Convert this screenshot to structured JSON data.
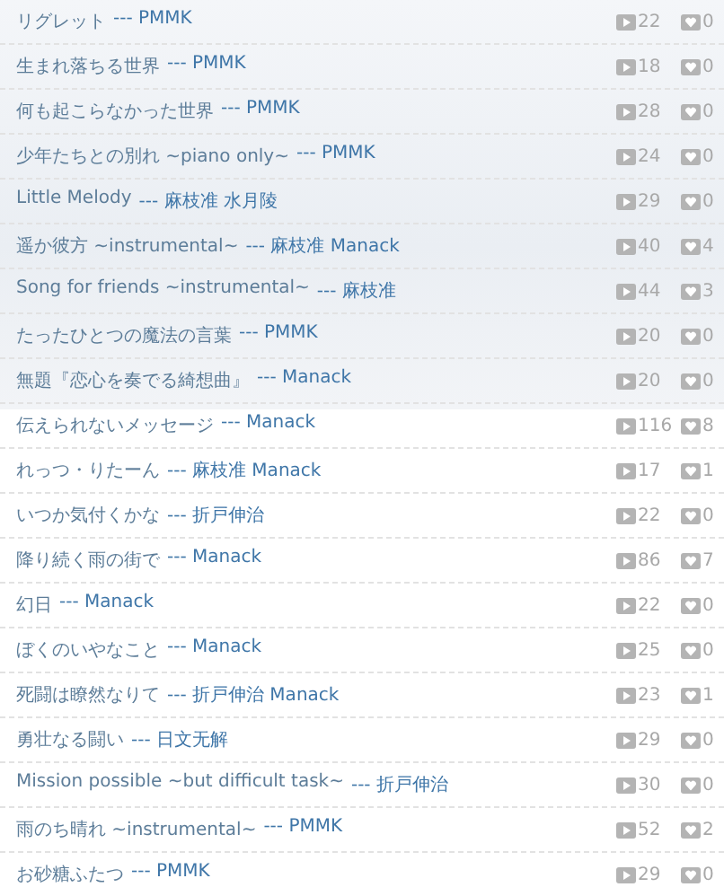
{
  "songs": [
    {
      "title": "リグレット",
      "credit": "--- PMMK",
      "plays": "22",
      "likes": "0"
    },
    {
      "title": "生まれ落ちる世界",
      "credit": "--- PMMK",
      "plays": "18",
      "likes": "0"
    },
    {
      "title": "何も起こらなかった世界",
      "credit": "--- PMMK",
      "plays": "28",
      "likes": "0"
    },
    {
      "title": "少年たちとの別れ ~piano only~",
      "credit": "--- PMMK",
      "plays": "24",
      "likes": "0"
    },
    {
      "title": "Little Melody",
      "credit": "--- 麻枝准 水月陵",
      "plays": "29",
      "likes": "0"
    },
    {
      "title": "遥か彼方 ~instrumental~",
      "credit": "--- 麻枝准 Manack",
      "plays": "40",
      "likes": "4"
    },
    {
      "title": "Song for friends ~instrumental~",
      "credit": "--- 麻枝准",
      "plays": "44",
      "likes": "3"
    },
    {
      "title": "たったひとつの魔法の言葉",
      "credit": "--- PMMK",
      "plays": "20",
      "likes": "0"
    },
    {
      "title": "無題『恋心を奏でる綺想曲』",
      "credit": "--- Manack",
      "plays": "20",
      "likes": "0"
    },
    {
      "title": "伝えられないメッセージ",
      "credit": "--- Manack",
      "plays": "116",
      "likes": "8"
    },
    {
      "title": "れっつ・りたーん",
      "credit": "--- 麻枝准 Manack",
      "plays": "17",
      "likes": "1"
    },
    {
      "title": "いつか気付くかな",
      "credit": "--- 折戸伸治",
      "plays": "22",
      "likes": "0"
    },
    {
      "title": "降り続く雨の街で",
      "credit": "--- Manack",
      "plays": "86",
      "likes": "7"
    },
    {
      "title": "幻日",
      "credit": "--- Manack",
      "plays": "22",
      "likes": "0"
    },
    {
      "title": "ぼくのいやなこと",
      "credit": "--- Manack",
      "plays": "25",
      "likes": "0"
    },
    {
      "title": "死闘は瞭然なりて",
      "credit": "--- 折戸伸治 Manack",
      "plays": "23",
      "likes": "1"
    },
    {
      "title": "勇壮なる闘い",
      "credit": "--- 日文无解",
      "plays": "29",
      "likes": "0"
    },
    {
      "title": "Mission possible ~but difficult task~",
      "credit": "--- 折戸伸治",
      "plays": "30",
      "likes": "0"
    },
    {
      "title": "雨のち晴れ ~instrumental~",
      "credit": "--- PMMK",
      "plays": "52",
      "likes": "2"
    },
    {
      "title": "お砂糖ふたつ",
      "credit": "--- PMMK",
      "plays": "29",
      "likes": "0"
    }
  ]
}
